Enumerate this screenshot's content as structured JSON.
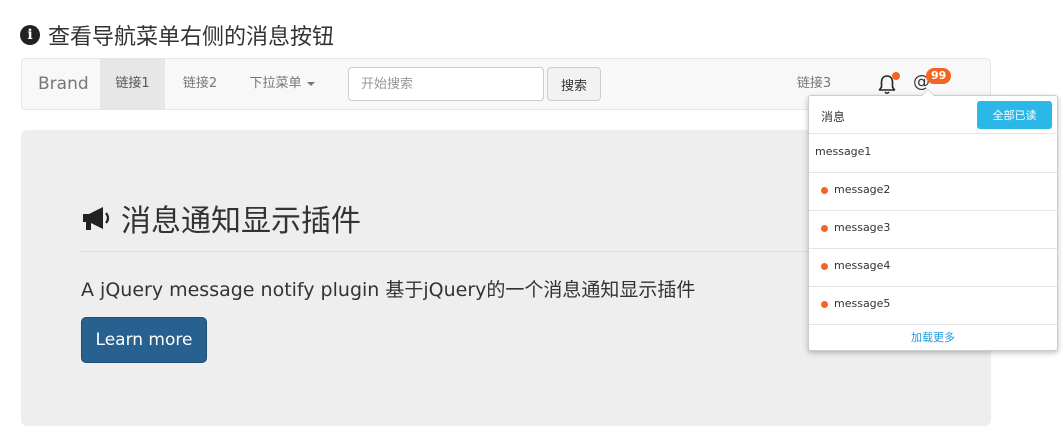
{
  "page": {
    "title": "查看导航菜单右侧的消息按钮"
  },
  "navbar": {
    "brand": "Brand",
    "links": [
      "链接1",
      "链接2"
    ],
    "dropdown_label": "下拉菜单",
    "search_placeholder": "开始搜索",
    "search_button": "搜索",
    "right_link": "链接3",
    "mention_badge": "99",
    "icons": [
      "bell-icon",
      "at-icon"
    ]
  },
  "jumbotron": {
    "heading": "消息通知显示插件",
    "text": "A jQuery message notify plugin 基于jQuery的一个消息通知显示插件",
    "button": "Learn more"
  },
  "notifications": {
    "header": "消息",
    "read_all": "全部已读",
    "messages": [
      {
        "text": "message1",
        "unread": false
      },
      {
        "text": "message2",
        "unread": true
      },
      {
        "text": "message3",
        "unread": true
      },
      {
        "text": "message4",
        "unread": true
      },
      {
        "text": "message5",
        "unread": true
      }
    ],
    "load_more": "加载更多"
  },
  "colors": {
    "accent_orange": "#f26522",
    "primary_blue": "#286090",
    "info_blue": "#2bb7e8",
    "link_blue": "#1e9be0"
  }
}
